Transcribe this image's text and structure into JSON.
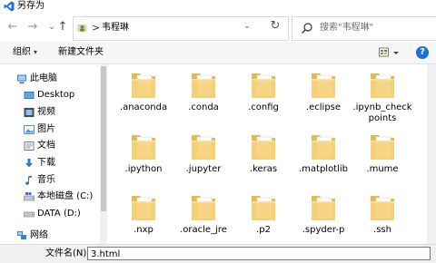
{
  "window": {
    "title": "另存为"
  },
  "address_bar": {
    "separator": ">",
    "crumb": "韦程琳"
  },
  "search": {
    "placeholder": "搜索\"韦程琳\""
  },
  "toolbar": {
    "organize": "组织",
    "new_folder": "新建文件夹",
    "help": "?"
  },
  "nav": {
    "items": [
      {
        "label": "此电脑",
        "icon": "computer-icon"
      },
      {
        "label": "Desktop",
        "icon": "desktop-icon"
      },
      {
        "label": "视频",
        "icon": "video-icon"
      },
      {
        "label": "图片",
        "icon": "pictures-icon"
      },
      {
        "label": "文档",
        "icon": "documents-icon"
      },
      {
        "label": "下载",
        "icon": "download-icon"
      },
      {
        "label": "音乐",
        "icon": "music-icon"
      },
      {
        "label": "本地磁盘 (C:)",
        "icon": "drive-c-icon"
      },
      {
        "label": "DATA (D:)",
        "icon": "drive-d-icon"
      },
      {
        "label": "网络",
        "icon": "network-icon"
      }
    ]
  },
  "files": [
    ".anaconda",
    ".conda",
    ".config",
    ".eclipse",
    ".ipynb_checkpoints",
    ".ipython",
    ".jupyter",
    ".keras",
    ".matplotlib",
    ".mume",
    ".nxp",
    ".oracle_jre",
    ".p2",
    ".spyder-p",
    ".ssh"
  ],
  "filename_row": {
    "label": "文件名(N):",
    "value": "3.html"
  },
  "colors": {
    "folder": "#f5d17a",
    "folder_dark": "#e8b94a",
    "accent": "#1f6fd0"
  }
}
